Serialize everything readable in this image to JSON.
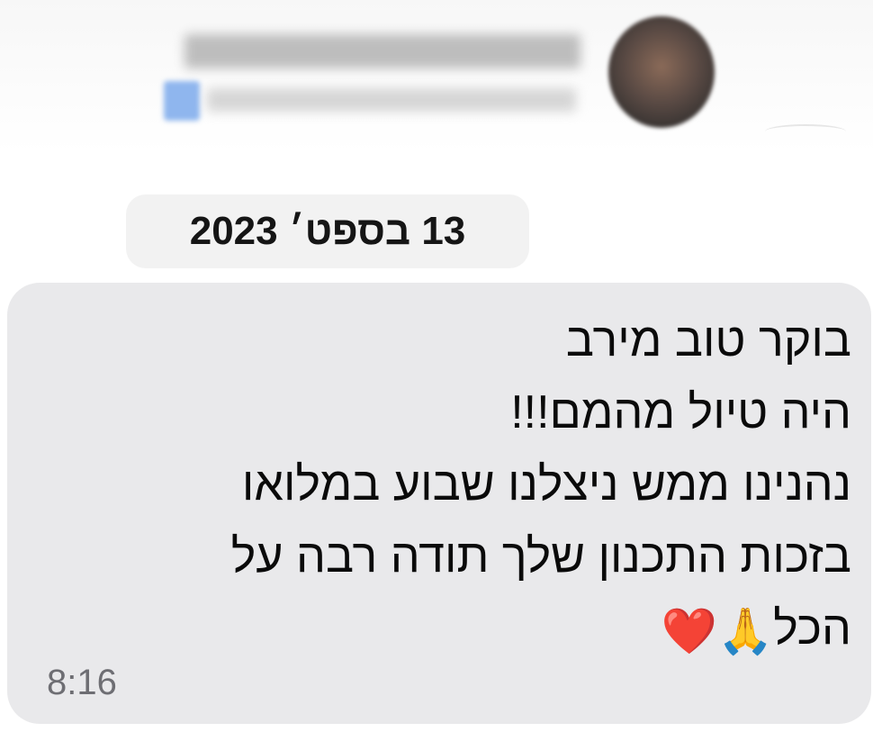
{
  "chat": {
    "date_separator": "13 בספט׳ 2023",
    "message": {
      "lines": [
        "בוקר טוב מירב",
        "היה טיול מהמם!!!",
        "נהנינו ממש ניצלנו שבוע במלואו",
        "בזכות התכנון שלך תודה רבה על"
      ],
      "last_line_text": "הכל",
      "emojis": [
        "🙏",
        "❤️"
      ],
      "time": "8:16"
    }
  },
  "icons": {
    "avatar": "contact-avatar",
    "verified": "verified-badge-icon",
    "prayer": "folded-hands-emoji",
    "heart": "red-heart-emoji"
  },
  "colors": {
    "bubble": "#e9e9eb",
    "date_pill": "#f2f2f2",
    "time": "#6e6e73",
    "heart": "#e0243a"
  }
}
